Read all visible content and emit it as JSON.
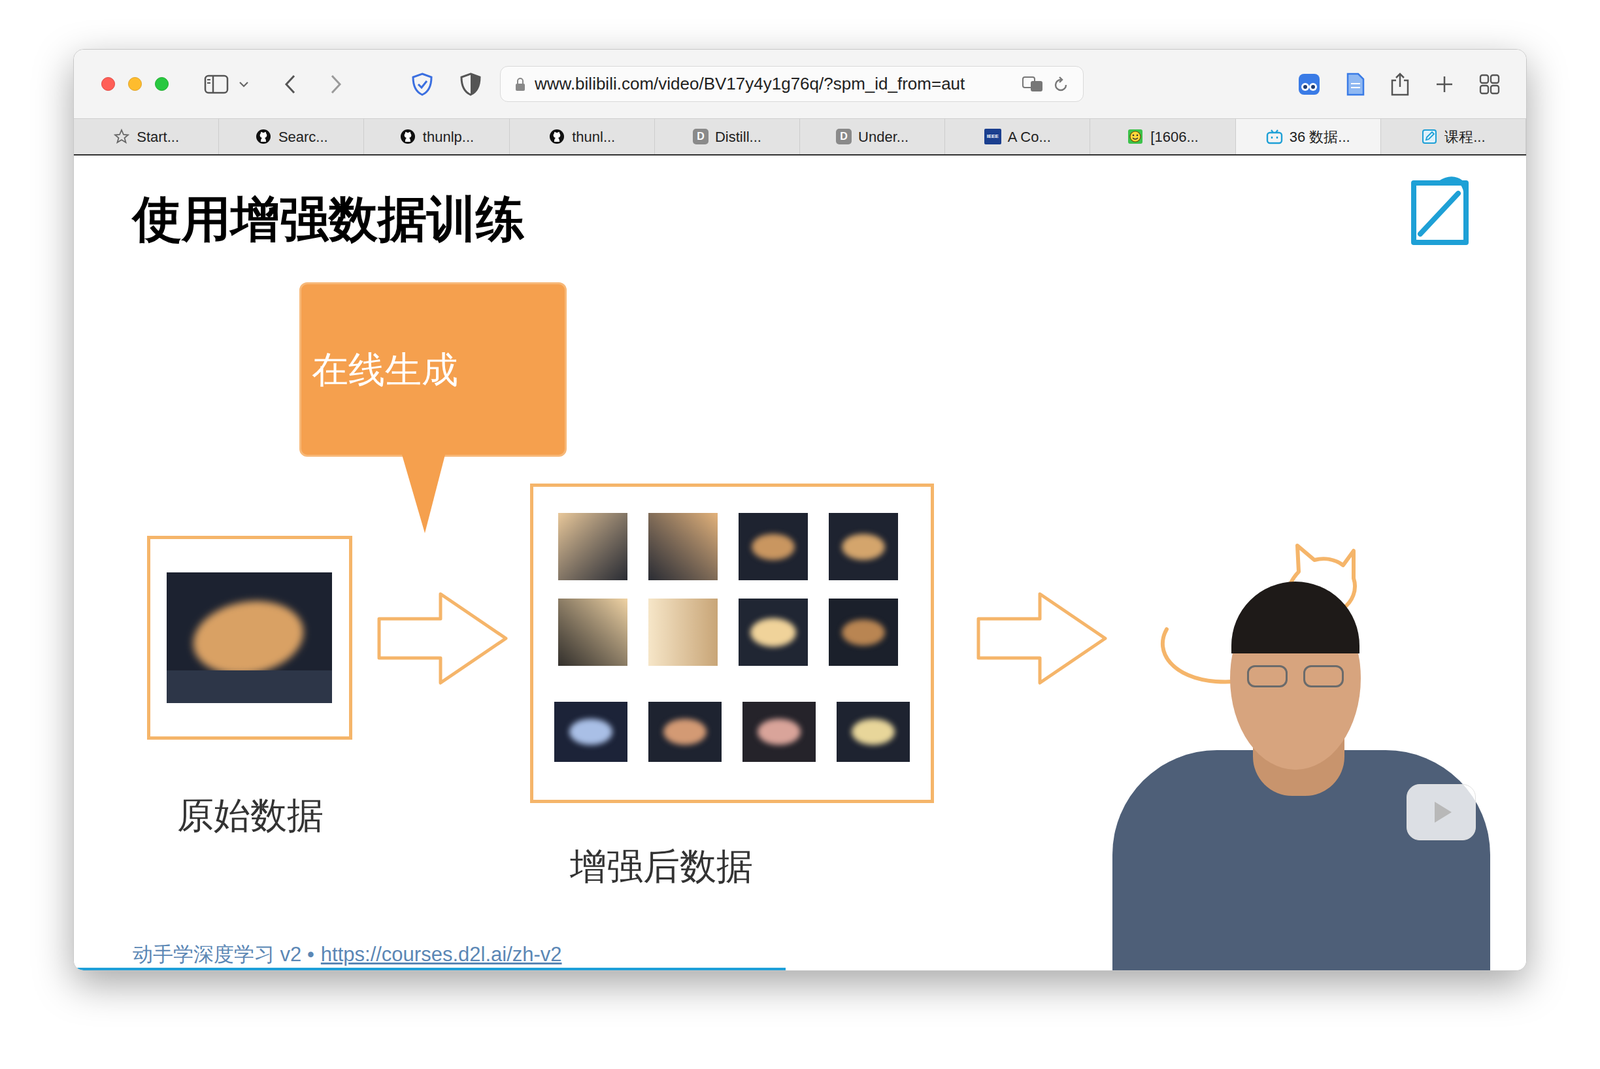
{
  "address_bar": {
    "url": "www.bilibili.com/video/BV17y4y1g76q/?spm_id_from=aut"
  },
  "tabs": [
    {
      "label": "Start...",
      "selected": false
    },
    {
      "label": "Searc...",
      "selected": false
    },
    {
      "label": "thunlp...",
      "selected": false
    },
    {
      "label": "thunl...",
      "selected": false
    },
    {
      "label": "Distill...",
      "selected": false,
      "badge": "D"
    },
    {
      "label": "Under...",
      "selected": false,
      "badge": "D"
    },
    {
      "label": "A Co...",
      "selected": false,
      "badge": "IEEE"
    },
    {
      "label": "[1606...",
      "selected": false
    },
    {
      "label": "36 数据...",
      "selected": true
    },
    {
      "label": "课程...",
      "selected": false
    }
  ],
  "slide": {
    "title": "使用增强数据训练",
    "callout": "在线生成",
    "original_label": "原始数据",
    "augmented_label": "增强后数据",
    "footer_text": "动手学深度学习 v2 •",
    "footer_link": "https://courses.d2l.ai/zh-v2"
  },
  "video": {
    "progress": 0.49
  }
}
